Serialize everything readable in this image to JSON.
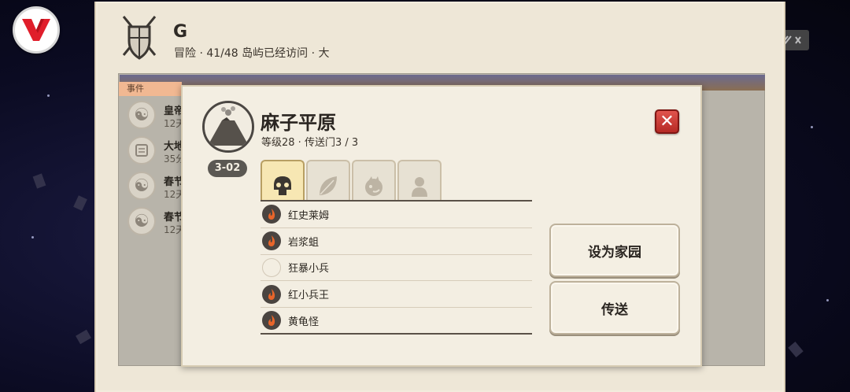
{
  "guild": {
    "name": "G",
    "meta": "冒险 · 41/48 岛屿已经访问 · 大"
  },
  "events": {
    "tab_label": "事件",
    "items": [
      {
        "title": "皇帝",
        "time": "12天",
        "icon": "yin-yang-icon"
      },
      {
        "title": "大地",
        "time": "35分",
        "icon": "scroll-icon"
      },
      {
        "title": "春节",
        "time": "12天",
        "icon": "yin-yang-icon"
      },
      {
        "title": "春节",
        "time": "12天",
        "icon": "yin-yang-icon"
      }
    ]
  },
  "island": {
    "code": "3-02",
    "name": "麻子平原",
    "meta": "等级28 · 传送门3 / 3"
  },
  "tabs": [
    {
      "name": "monsters-tab",
      "icon": "skull-icon",
      "active": true
    },
    {
      "name": "resources-tab",
      "icon": "leaf-icon",
      "active": false
    },
    {
      "name": "pets-tab",
      "icon": "dragon-icon",
      "active": false
    },
    {
      "name": "npc-tab",
      "icon": "person-icon",
      "active": false
    }
  ],
  "monsters": [
    {
      "name": "红史莱姆",
      "icon": "fire"
    },
    {
      "name": "岩浆蛆",
      "icon": "fire"
    },
    {
      "name": "狂暴小兵",
      "icon": "empty"
    },
    {
      "name": "红小兵王",
      "icon": "fire"
    },
    {
      "name": "黄龟怪",
      "icon": "fire"
    }
  ],
  "buttons": {
    "set_home": "设为家园",
    "teleport": "传送"
  },
  "colors": {
    "parchment": "#eee7d7",
    "dialog": "#f3eee2",
    "close_red": "#c8322c",
    "active_tab": "#f7e7b3"
  }
}
